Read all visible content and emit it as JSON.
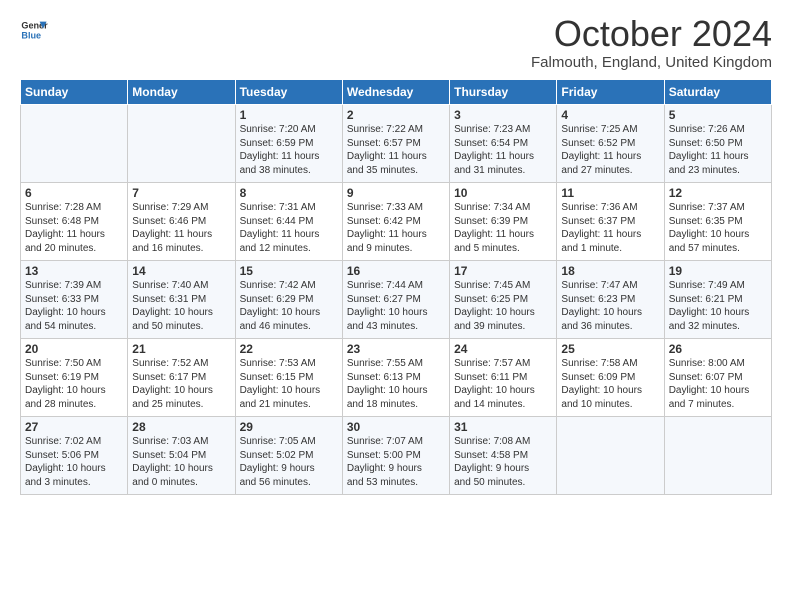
{
  "header": {
    "logo_general": "General",
    "logo_blue": "Blue",
    "month": "October 2024",
    "location": "Falmouth, England, United Kingdom"
  },
  "days_of_week": [
    "Sunday",
    "Monday",
    "Tuesday",
    "Wednesday",
    "Thursday",
    "Friday",
    "Saturday"
  ],
  "weeks": [
    [
      {
        "day": "",
        "lines": []
      },
      {
        "day": "",
        "lines": []
      },
      {
        "day": "1",
        "lines": [
          "Sunrise: 7:20 AM",
          "Sunset: 6:59 PM",
          "Daylight: 11 hours",
          "and 38 minutes."
        ]
      },
      {
        "day": "2",
        "lines": [
          "Sunrise: 7:22 AM",
          "Sunset: 6:57 PM",
          "Daylight: 11 hours",
          "and 35 minutes."
        ]
      },
      {
        "day": "3",
        "lines": [
          "Sunrise: 7:23 AM",
          "Sunset: 6:54 PM",
          "Daylight: 11 hours",
          "and 31 minutes."
        ]
      },
      {
        "day": "4",
        "lines": [
          "Sunrise: 7:25 AM",
          "Sunset: 6:52 PM",
          "Daylight: 11 hours",
          "and 27 minutes."
        ]
      },
      {
        "day": "5",
        "lines": [
          "Sunrise: 7:26 AM",
          "Sunset: 6:50 PM",
          "Daylight: 11 hours",
          "and 23 minutes."
        ]
      }
    ],
    [
      {
        "day": "6",
        "lines": [
          "Sunrise: 7:28 AM",
          "Sunset: 6:48 PM",
          "Daylight: 11 hours",
          "and 20 minutes."
        ]
      },
      {
        "day": "7",
        "lines": [
          "Sunrise: 7:29 AM",
          "Sunset: 6:46 PM",
          "Daylight: 11 hours",
          "and 16 minutes."
        ]
      },
      {
        "day": "8",
        "lines": [
          "Sunrise: 7:31 AM",
          "Sunset: 6:44 PM",
          "Daylight: 11 hours",
          "and 12 minutes."
        ]
      },
      {
        "day": "9",
        "lines": [
          "Sunrise: 7:33 AM",
          "Sunset: 6:42 PM",
          "Daylight: 11 hours",
          "and 9 minutes."
        ]
      },
      {
        "day": "10",
        "lines": [
          "Sunrise: 7:34 AM",
          "Sunset: 6:39 PM",
          "Daylight: 11 hours",
          "and 5 minutes."
        ]
      },
      {
        "day": "11",
        "lines": [
          "Sunrise: 7:36 AM",
          "Sunset: 6:37 PM",
          "Daylight: 11 hours",
          "and 1 minute."
        ]
      },
      {
        "day": "12",
        "lines": [
          "Sunrise: 7:37 AM",
          "Sunset: 6:35 PM",
          "Daylight: 10 hours",
          "and 57 minutes."
        ]
      }
    ],
    [
      {
        "day": "13",
        "lines": [
          "Sunrise: 7:39 AM",
          "Sunset: 6:33 PM",
          "Daylight: 10 hours",
          "and 54 minutes."
        ]
      },
      {
        "day": "14",
        "lines": [
          "Sunrise: 7:40 AM",
          "Sunset: 6:31 PM",
          "Daylight: 10 hours",
          "and 50 minutes."
        ]
      },
      {
        "day": "15",
        "lines": [
          "Sunrise: 7:42 AM",
          "Sunset: 6:29 PM",
          "Daylight: 10 hours",
          "and 46 minutes."
        ]
      },
      {
        "day": "16",
        "lines": [
          "Sunrise: 7:44 AM",
          "Sunset: 6:27 PM",
          "Daylight: 10 hours",
          "and 43 minutes."
        ]
      },
      {
        "day": "17",
        "lines": [
          "Sunrise: 7:45 AM",
          "Sunset: 6:25 PM",
          "Daylight: 10 hours",
          "and 39 minutes."
        ]
      },
      {
        "day": "18",
        "lines": [
          "Sunrise: 7:47 AM",
          "Sunset: 6:23 PM",
          "Daylight: 10 hours",
          "and 36 minutes."
        ]
      },
      {
        "day": "19",
        "lines": [
          "Sunrise: 7:49 AM",
          "Sunset: 6:21 PM",
          "Daylight: 10 hours",
          "and 32 minutes."
        ]
      }
    ],
    [
      {
        "day": "20",
        "lines": [
          "Sunrise: 7:50 AM",
          "Sunset: 6:19 PM",
          "Daylight: 10 hours",
          "and 28 minutes."
        ]
      },
      {
        "day": "21",
        "lines": [
          "Sunrise: 7:52 AM",
          "Sunset: 6:17 PM",
          "Daylight: 10 hours",
          "and 25 minutes."
        ]
      },
      {
        "day": "22",
        "lines": [
          "Sunrise: 7:53 AM",
          "Sunset: 6:15 PM",
          "Daylight: 10 hours",
          "and 21 minutes."
        ]
      },
      {
        "day": "23",
        "lines": [
          "Sunrise: 7:55 AM",
          "Sunset: 6:13 PM",
          "Daylight: 10 hours",
          "and 18 minutes."
        ]
      },
      {
        "day": "24",
        "lines": [
          "Sunrise: 7:57 AM",
          "Sunset: 6:11 PM",
          "Daylight: 10 hours",
          "and 14 minutes."
        ]
      },
      {
        "day": "25",
        "lines": [
          "Sunrise: 7:58 AM",
          "Sunset: 6:09 PM",
          "Daylight: 10 hours",
          "and 10 minutes."
        ]
      },
      {
        "day": "26",
        "lines": [
          "Sunrise: 8:00 AM",
          "Sunset: 6:07 PM",
          "Daylight: 10 hours",
          "and 7 minutes."
        ]
      }
    ],
    [
      {
        "day": "27",
        "lines": [
          "Sunrise: 7:02 AM",
          "Sunset: 5:06 PM",
          "Daylight: 10 hours",
          "and 3 minutes."
        ]
      },
      {
        "day": "28",
        "lines": [
          "Sunrise: 7:03 AM",
          "Sunset: 5:04 PM",
          "Daylight: 10 hours",
          "and 0 minutes."
        ]
      },
      {
        "day": "29",
        "lines": [
          "Sunrise: 7:05 AM",
          "Sunset: 5:02 PM",
          "Daylight: 9 hours",
          "and 56 minutes."
        ]
      },
      {
        "day": "30",
        "lines": [
          "Sunrise: 7:07 AM",
          "Sunset: 5:00 PM",
          "Daylight: 9 hours",
          "and 53 minutes."
        ]
      },
      {
        "day": "31",
        "lines": [
          "Sunrise: 7:08 AM",
          "Sunset: 4:58 PM",
          "Daylight: 9 hours",
          "and 50 minutes."
        ]
      },
      {
        "day": "",
        "lines": []
      },
      {
        "day": "",
        "lines": []
      }
    ]
  ]
}
